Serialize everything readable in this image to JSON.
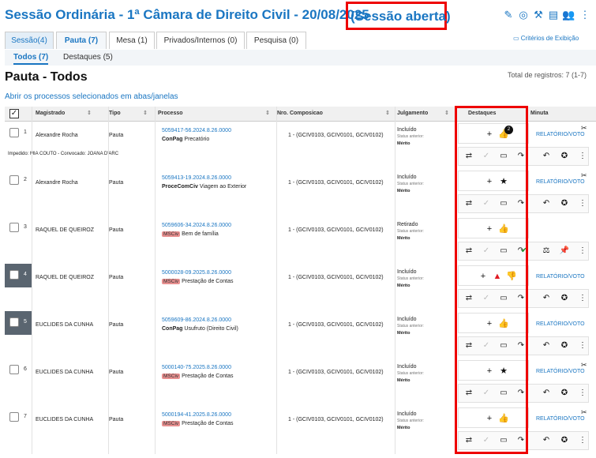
{
  "header": {
    "title": "Sessão Ordinária - 1ª Câmara de Direito Civil - 20/08/2025",
    "status": "(Sessão aberta)"
  },
  "tabs": [
    {
      "label": "Sessão(4)"
    },
    {
      "label": "Pauta (7)"
    },
    {
      "label": "Mesa (1)"
    },
    {
      "label": "Privados/Internos (0)"
    },
    {
      "label": "Pesquisa (0)"
    }
  ],
  "criteria_label": "Critérios de Exibição",
  "subtabs": [
    {
      "label": "Todos (7)"
    },
    {
      "label": "Destaques (5)"
    }
  ],
  "page_title": "Pauta - Todos",
  "total": "Total de registros: 7 (1-7)",
  "open_link": "Abrir os processos selecionados em abas/janelas",
  "columns": {
    "magistrado": "Magistrado",
    "tipo": "Tipo",
    "processo": "Processo",
    "composicao": "Nro. Composicao",
    "julgamento": "Julgamento",
    "destaques": "Destaques",
    "minuta": "Minuta"
  },
  "rows": [
    {
      "n": "1",
      "mag": "Alexandre Rocha",
      "tipo": "Pauta",
      "proc": "5059417-56.2024.8.26.0000",
      "tag": "ConPag",
      "tag_style": "white",
      "cls": "Precatório",
      "comp": "1 - (GCIV0103, GCIV0101, GCIV0102)",
      "jul": "Incluído",
      "sa": "Status anterior:",
      "mer": "Mérito",
      "minuta": "RELATÓRIO/VOTO",
      "badge": "2",
      "imped": "Impedido: MIA COUTO - Convocado: JOANA D'ARC"
    },
    {
      "n": "2",
      "mag": "Alexandre Rocha",
      "tipo": "Pauta",
      "proc": "5059413-19.2024.8.26.0000",
      "tag": "ProceComCiv",
      "tag_style": "white",
      "cls": "Viagem ao Exterior",
      "comp": "1 - (GCIV0103, GCIV0101, GCIV0102)",
      "jul": "Incluído",
      "sa": "Status anterior:",
      "mer": "Mérito",
      "minuta": "RELATÓRIO/VOTO"
    },
    {
      "n": "3",
      "mag": "RAQUEL DE QUEIROZ",
      "tipo": "Pauta",
      "proc": "5059606-34.2024.8.26.0000",
      "tag": "MSCiv",
      "tag_style": "red",
      "cls": "Bem de família",
      "comp": "1 - (GCIV0103, GCIV0101, GCIV0102)",
      "jul": "Retirado",
      "sa": "Status anterior:",
      "mer": "Mérito",
      "minuta": ""
    },
    {
      "n": "4",
      "mag": "RAQUEL DE QUEIROZ",
      "tipo": "Pauta",
      "proc": "5000028-09.2025.8.26.0000",
      "tag": "MSCiv",
      "tag_style": "red",
      "cls": "Prestação de Contas",
      "comp": "1 - (GCIV0103, GCIV0101, GCIV0102)",
      "jul": "Incluído",
      "sa": "Status anterior:",
      "mer": "Mérito",
      "minuta": "RELATÓRIO/VOTO"
    },
    {
      "n": "5",
      "mag": "EUCLIDES DA CUNHA",
      "tipo": "Pauta",
      "proc": "5059609-86.2024.8.26.0000",
      "tag": "ConPag",
      "tag_style": "white",
      "cls": "Usufruto (Direito Civil)",
      "comp": "1 - (GCIV0103, GCIV0101, GCIV0102)",
      "jul": "Incluído",
      "sa": "Status anterior:",
      "mer": "Mérito",
      "minuta": "RELATÓRIO/VOTO"
    },
    {
      "n": "6",
      "mag": "EUCLIDES DA CUNHA",
      "tipo": "Pauta",
      "proc": "5000140-75.2025.8.26.0000",
      "tag": "MSCiv",
      "tag_style": "red",
      "cls": "Prestação de Contas",
      "comp": "1 - (GCIV0103, GCIV0101, GCIV0102)",
      "jul": "Incluído",
      "sa": "Status anterior:",
      "mer": "Mérito",
      "minuta": "RELATÓRIO/VOTO"
    },
    {
      "n": "7",
      "mag": "EUCLIDES DA CUNHA",
      "tipo": "Pauta",
      "proc": "5000194-41.2025.8.26.0000",
      "tag": "MSCiv",
      "tag_style": "red",
      "cls": "Prestação de Contas",
      "comp": "1 - (GCIV0103, GCIV0101, GCIV0102)",
      "jul": "Incluído",
      "sa": "Status anterior:",
      "mer": "Mérito",
      "minuta": "RELATÓRIO/VOTO"
    }
  ]
}
